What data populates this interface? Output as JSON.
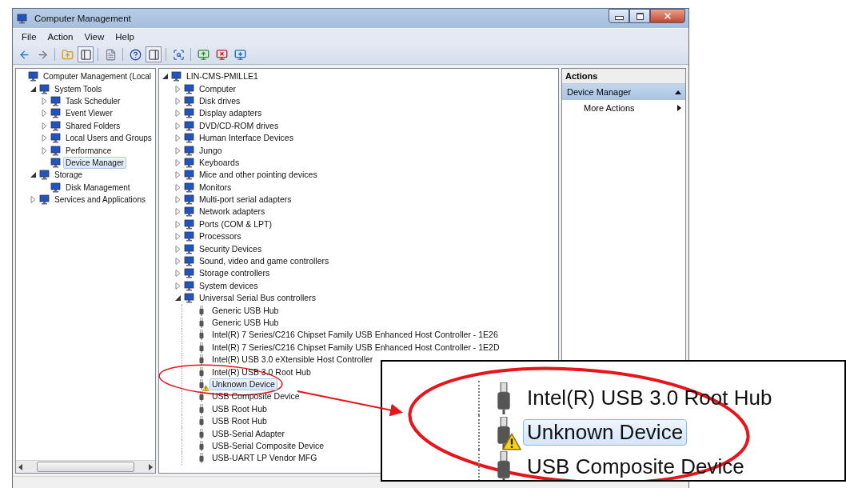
{
  "window": {
    "title": "Computer Management"
  },
  "menu": [
    "File",
    "Action",
    "View",
    "Help"
  ],
  "left_tree": [
    {
      "label": "Computer Management (Local",
      "selected": false,
      "children": [
        {
          "label": "System Tools",
          "expanded": true,
          "selected": false,
          "children": [
            {
              "label": "Task Scheduler",
              "expanded": false,
              "selected": false
            },
            {
              "label": "Event Viewer",
              "expanded": false,
              "selected": false
            },
            {
              "label": "Shared Folders",
              "expanded": false,
              "selected": false
            },
            {
              "label": "Local Users and Groups",
              "expanded": false,
              "selected": false
            },
            {
              "label": "Performance",
              "expanded": false,
              "selected": false
            },
            {
              "label": "Device Manager",
              "selected": true
            }
          ]
        },
        {
          "label": "Storage",
          "expanded": true,
          "selected": false,
          "children": [
            {
              "label": "Disk Management",
              "selected": false
            }
          ]
        },
        {
          "label": "Services and Applications",
          "expanded": false,
          "selected": false
        }
      ]
    }
  ],
  "device_tree": [
    {
      "label": "LIN-CMS-PMILLE1",
      "expanded": true,
      "selected": false,
      "children": [
        {
          "label": "Computer",
          "expanded": false,
          "selected": false
        },
        {
          "label": "Disk drives",
          "expanded": false,
          "selected": false
        },
        {
          "label": "Display adapters",
          "expanded": false,
          "selected": false
        },
        {
          "label": "DVD/CD-ROM drives",
          "expanded": false,
          "selected": false
        },
        {
          "label": "Human Interface Devices",
          "expanded": false,
          "selected": false
        },
        {
          "label": "Jungo",
          "expanded": false,
          "selected": false
        },
        {
          "label": "Keyboards",
          "expanded": false,
          "selected": false
        },
        {
          "label": "Mice and other pointing devices",
          "expanded": false,
          "selected": false
        },
        {
          "label": "Monitors",
          "expanded": false,
          "selected": false
        },
        {
          "label": "Multi-port serial adapters",
          "expanded": false,
          "selected": false
        },
        {
          "label": "Network adapters",
          "expanded": false,
          "selected": false
        },
        {
          "label": "Ports (COM & LPT)",
          "expanded": false,
          "selected": false
        },
        {
          "label": "Processors",
          "expanded": false,
          "selected": false
        },
        {
          "label": "Security Devices",
          "expanded": false,
          "selected": false
        },
        {
          "label": "Sound, video and game controllers",
          "expanded": false,
          "selected": false
        },
        {
          "label": "Storage controllers",
          "expanded": false,
          "selected": false
        },
        {
          "label": "System devices",
          "expanded": false,
          "selected": false
        },
        {
          "label": "Universal Serial Bus controllers",
          "expanded": true,
          "selected": false,
          "children": [
            {
              "label": "Generic USB Hub",
              "selected": false,
              "warning": false
            },
            {
              "label": "Generic USB Hub",
              "selected": false,
              "warning": false
            },
            {
              "label": "Intel(R) 7 Series/C216 Chipset Family USB Enhanced Host Controller - 1E26",
              "selected": false,
              "warning": false
            },
            {
              "label": "Intel(R) 7 Series/C216 Chipset Family USB Enhanced Host Controller - 1E2D",
              "selected": false,
              "warning": false
            },
            {
              "label": "Intel(R) USB 3.0 eXtensible Host Controller",
              "selected": false,
              "warning": false
            },
            {
              "label": "Intel(R) USB 3.0 Root Hub",
              "selected": false,
              "warning": false
            },
            {
              "label": "Unknown Device",
              "selected": true,
              "warning": true
            },
            {
              "label": "USB Composite Device",
              "selected": false,
              "warning": false
            },
            {
              "label": "USB Root Hub",
              "selected": false,
              "warning": false
            },
            {
              "label": "USB Root Hub",
              "selected": false,
              "warning": false
            },
            {
              "label": "USB-Serial Adapter",
              "selected": false,
              "warning": false
            },
            {
              "label": "USB-Serial Composite Device",
              "selected": false,
              "warning": false
            },
            {
              "label": "USB-UART LP Vendor MFG",
              "selected": false,
              "warning": false
            }
          ]
        }
      ]
    }
  ],
  "actions": {
    "title": "Actions",
    "sections": [
      {
        "label": "Device Manager",
        "expanded": true,
        "items": [
          {
            "label": "More Actions",
            "submenu": true
          }
        ]
      }
    ]
  },
  "zoom_inset": {
    "rows": [
      {
        "label": "Intel(R) USB 3.0 Root Hub",
        "selected": false,
        "warning": false
      },
      {
        "label": "Unknown Device",
        "selected": true,
        "warning": true
      },
      {
        "label": "USB Composite Device",
        "selected": false,
        "warning": false
      }
    ]
  }
}
